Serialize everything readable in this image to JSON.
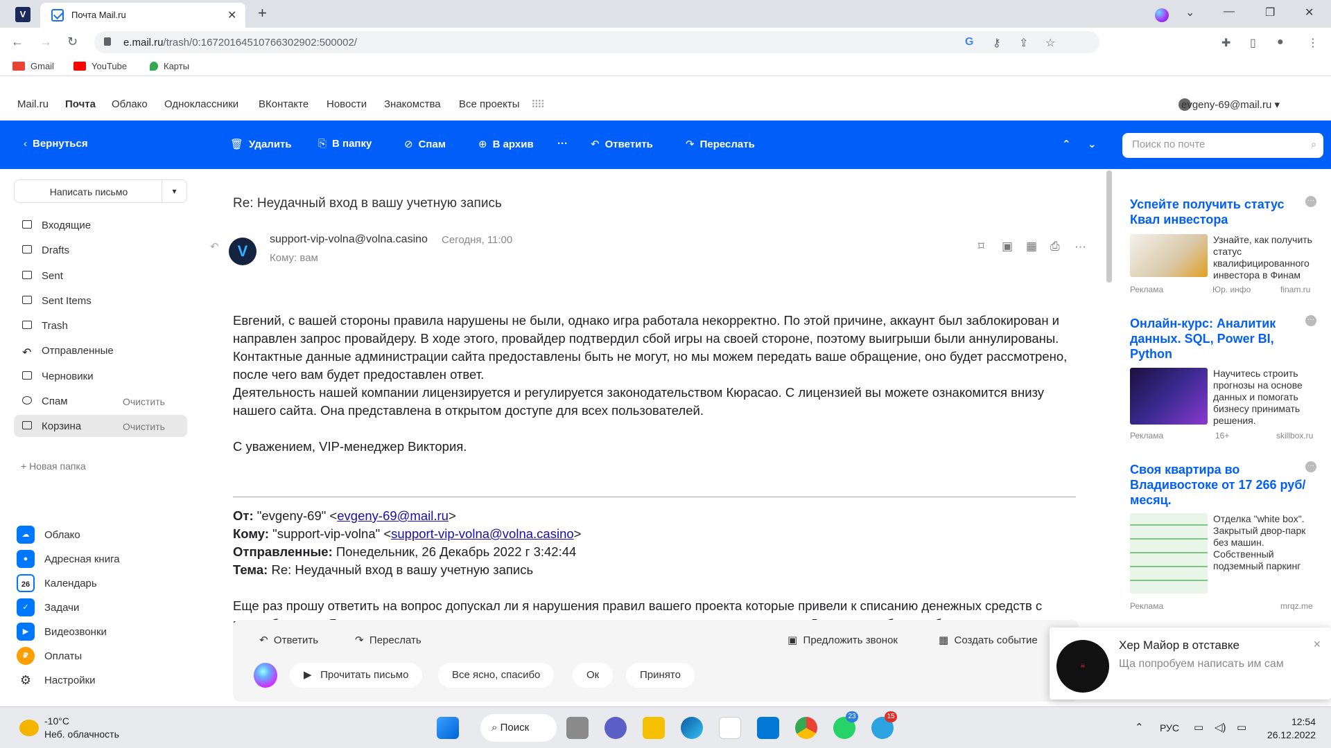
{
  "browser": {
    "tab_title": "Почта Mail.ru",
    "url_domain": "e.mail.ru",
    "url_path": "/trash/0:16720164510766302902:500002/",
    "bookmarks": [
      "Gmail",
      "YouTube",
      "Карты"
    ]
  },
  "portal": {
    "links": [
      "Mail.ru",
      "Почта",
      "Облако",
      "Одноклассники",
      "ВКонтакте",
      "Новости",
      "Знакомства",
      "Все проекты"
    ],
    "user": "evgeny-69@mail.ru ▾"
  },
  "toolbar": {
    "back": "Вернуться",
    "delete": "Удалить",
    "to_folder": "В папку",
    "spam": "Спам",
    "archive": "В архив",
    "more": "···",
    "reply": "Ответить",
    "forward": "Переслать",
    "search_placeholder": "Поиск по почте"
  },
  "sidebar": {
    "compose": "Написать письмо",
    "folders": [
      {
        "name": "Входящие",
        "action": ""
      },
      {
        "name": "Drafts",
        "action": ""
      },
      {
        "name": "Sent",
        "action": ""
      },
      {
        "name": "Sent Items",
        "action": ""
      },
      {
        "name": "Trash",
        "action": ""
      },
      {
        "name": "Отправленные",
        "action": ""
      },
      {
        "name": "Черновики",
        "action": ""
      },
      {
        "name": "Спам",
        "action": "Очистить"
      },
      {
        "name": "Корзина",
        "action": "Очистить"
      }
    ],
    "new_folder": "+ Новая папка",
    "apps": [
      "Облако",
      "Адресная книга",
      "Календарь",
      "Задачи",
      "Видеозвонки",
      "Оплаты",
      "Настройки"
    ],
    "calendar_day": "26"
  },
  "message": {
    "subject": "Re: Неудачный вход в вашу учетную запись",
    "sender": "support-vip-volna@volna.casino",
    "date": "Сегодня, 11:00",
    "to": "Кому: вам",
    "body": [
      "Евгений, с вашей стороны правила нарушены не были, однако игра работала некорректно. По этой причине, аккаунт был заблокирован и направлен запрос провайдеру. В ходе этого, провайдер подтвердил сбой игры на своей стороне, поэтому выигрыши были аннулированы.",
      "Контактные данные администрации сайта предоставлены быть не могут, но мы можем передать ваше обращение, оно будет рассмотрено, после чего вам будет предоставлен ответ.",
      "Деятельность нашей компании лицензируется и регулируется законодательством Кюрасао. С лицензией вы можете ознакомится внизу нашего сайта. Она представлена в открытом доступе для всех пользователей."
    ],
    "signature": "С уважением, VIP-менеджер Виктория.",
    "quote": {
      "from_label": "От:",
      "from_name": "\"evgeny-69\" <",
      "from_email": "evgeny-69@mail.ru",
      "to_label": "Кому:",
      "to_name": "\"support-vip-volna\" <",
      "to_email": "support-vip-volna@volna.casino",
      "sent_label": "Отправленные:",
      "sent_value": "Понедельник, 26 Декабрь 2022 г 3:42:44",
      "subject_label": "Тема:",
      "subject_value": "Re: Неудачный вход в вашу учетную запись",
      "text": "Еще раз прошу ответить на вопрос допускал ли я нарушения правил вашего проекта которые привели к списанию денежных средств с моего баланса. Я самостоятельно не зашел в игру, контрол и самостоятельно не вышел из нее. Доступ игры был свободен"
    }
  },
  "quick_reply": {
    "reply": "Ответить",
    "forward": "Переслать",
    "call": "Предложить звонок",
    "event": "Создать событие",
    "chips": [
      "Прочитать письмо",
      "Все ясно, спасибо",
      "Ок",
      "Принято"
    ]
  },
  "ads": [
    {
      "title": "Успейте получить статус Квал инвестора",
      "text": "Узнайте, как получить статус квалифицированного инвестора в Финам",
      "label": "Реклама",
      "mid": "Юр. инфо",
      "domain": "finam.ru"
    },
    {
      "title": "Онлайн-курс: Аналитик данных. SQL, Power BI, Python",
      "text": "Научитесь строить прогнозы на основе данных и помогать бизнесу принимать решения.",
      "label": "Реклама",
      "mid": "16+",
      "domain": "skillbox.ru"
    },
    {
      "title": "Своя квартира во Владивостоке от 17 266 руб/месяц.",
      "text": "Отделка \"white box\". Закрытый двор-парк без машин. Собственный подземный паркинг",
      "label": "Реклама",
      "mid": "",
      "domain": "mrqz.me"
    }
  ],
  "notification": {
    "title": "Хер Майор в отставке",
    "text": "Ща попробуем написать им сам"
  },
  "taskbar": {
    "temp": "-10°C",
    "weather": "Неб. облачность",
    "search": "Поиск",
    "lang": "РУС",
    "time": "12:54",
    "date": "26.12.2022",
    "badge_whatsapp": "23",
    "badge_telegram": "15"
  },
  "colors": {
    "accent": "#005ff9",
    "link": "#005ff9"
  }
}
